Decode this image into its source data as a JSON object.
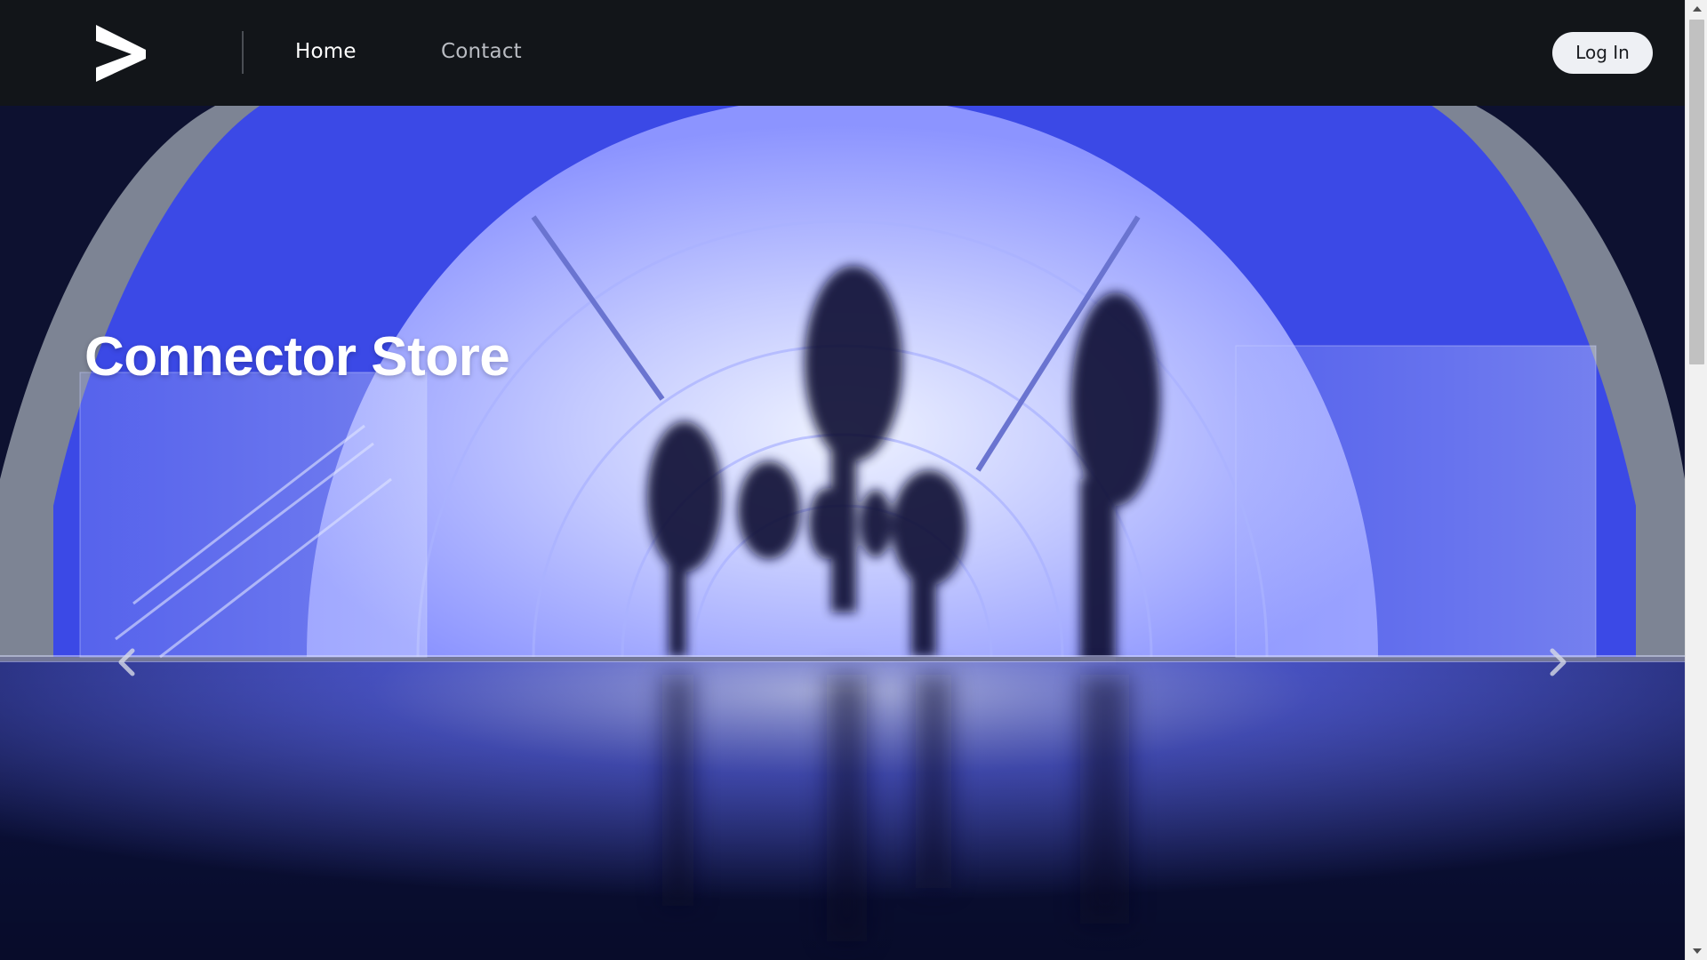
{
  "header": {
    "logo_icon": "accenture-greater-than-logo-icon",
    "nav": [
      {
        "label": "Home",
        "active": true
      },
      {
        "label": "Contact",
        "active": false
      }
    ],
    "login_label": "Log In"
  },
  "hero": {
    "title": "Connector Store",
    "prev_icon": "chevron-left-icon",
    "next_icon": "chevron-right-icon"
  },
  "colors": {
    "header_bg": "#121519",
    "hero_blue": "#3d4ef0",
    "login_bg": "#eef0f4",
    "nav_active": "#ffffff",
    "nav_inactive": "#b9bcc2"
  }
}
